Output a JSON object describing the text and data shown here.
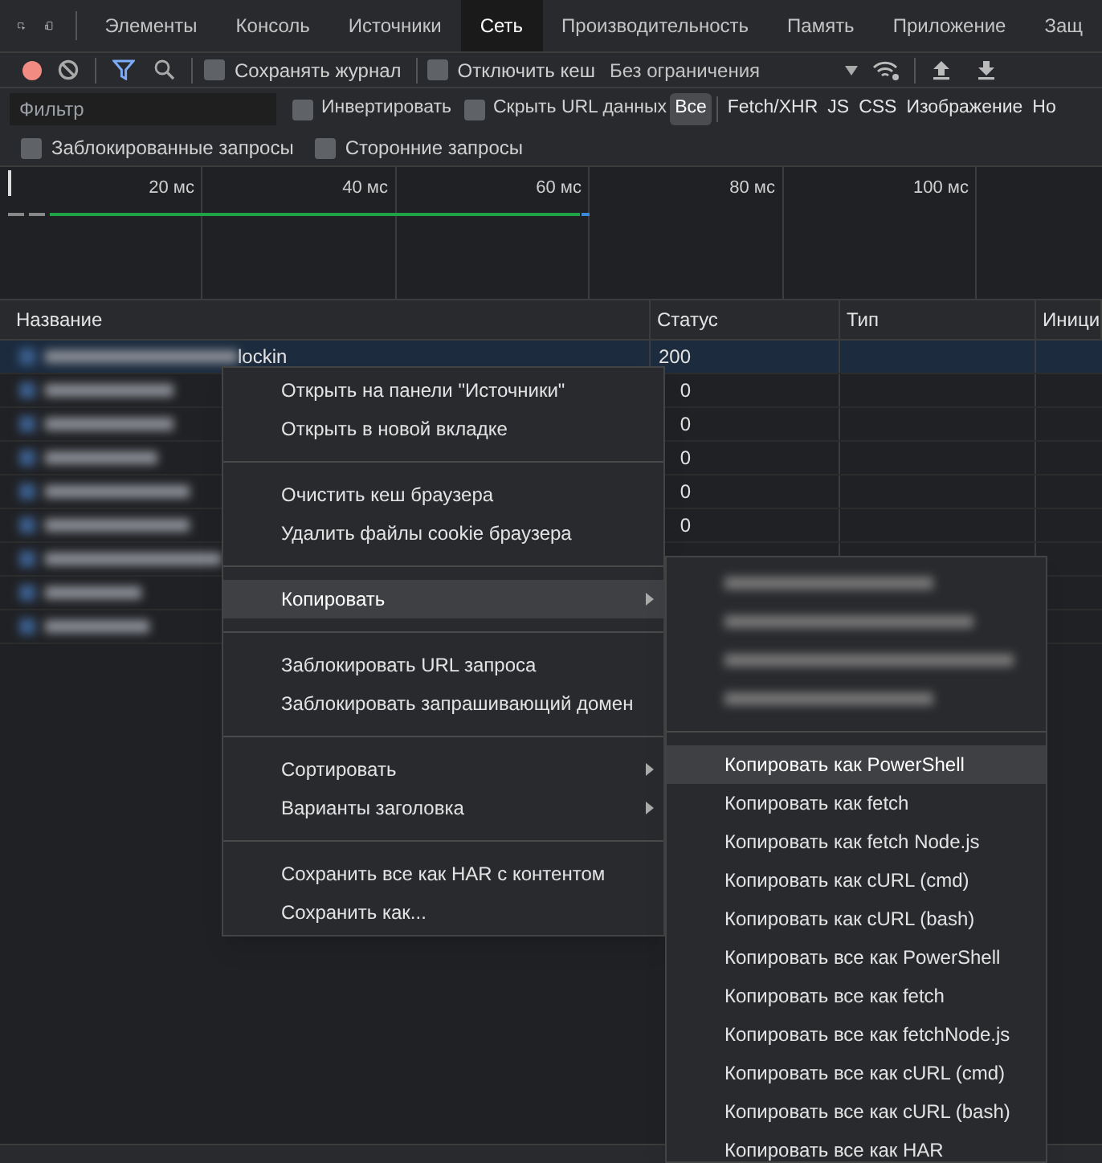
{
  "panel_tabs": [
    {
      "label": "Элементы",
      "selected": false
    },
    {
      "label": "Консоль",
      "selected": false
    },
    {
      "label": "Источники",
      "selected": false
    },
    {
      "label": "Сеть",
      "selected": true
    },
    {
      "label": "Производительность",
      "selected": false
    },
    {
      "label": "Память",
      "selected": false
    },
    {
      "label": "Приложение",
      "selected": false
    },
    {
      "label": "Защ",
      "selected": false
    }
  ],
  "toolbar": {
    "recording": true,
    "preserve_log": {
      "label": "Сохранять журнал",
      "checked": false
    },
    "disable_cache": {
      "label": "Отключить кеш",
      "checked": false
    },
    "throttling": "Без ограничения"
  },
  "filter_bar": {
    "placeholder": "Фильтр",
    "invert": {
      "label": "Инвертировать",
      "checked": false
    },
    "hide_data_urls": {
      "label": "Скрыть URL данных",
      "checked": false
    },
    "types": [
      {
        "label": "Все",
        "selected": true
      },
      {
        "label": "Fetch/XHR",
        "selected": false
      },
      {
        "label": "JS",
        "selected": false
      },
      {
        "label": "CSS",
        "selected": false
      },
      {
        "label": "Изображение",
        "selected": false
      },
      {
        "label": "Но",
        "selected": false
      }
    ],
    "blocked_requests": {
      "label": "Заблокированные запросы",
      "checked": false
    },
    "third_party": {
      "label": "Сторонние запросы",
      "checked": false
    }
  },
  "timeline": {
    "ticks": [
      "20 мс",
      "40 мс",
      "60 мс",
      "80 мс",
      "100 мс"
    ]
  },
  "table": {
    "columns": [
      "Название",
      "Статус",
      "Тип",
      "Иници"
    ],
    "rows": [
      {
        "selected": true,
        "name": "lockin",
        "status": "200"
      },
      {
        "selected": false,
        "status": "0"
      },
      {
        "selected": false,
        "status": "0"
      },
      {
        "selected": false,
        "status": "0"
      },
      {
        "selected": false,
        "status": "0"
      },
      {
        "selected": false,
        "status": "0"
      },
      {
        "selected": false
      },
      {
        "selected": false
      },
      {
        "selected": false
      }
    ]
  },
  "context_menu": {
    "items": [
      {
        "kind": "item",
        "label": "Открыть на панели \"Источники\"",
        "highlighted": false,
        "submenu": false
      },
      {
        "kind": "item",
        "label": "Открыть в новой вкладке",
        "highlighted": false,
        "submenu": false
      },
      {
        "kind": "separator"
      },
      {
        "kind": "item",
        "label": "Очистить кеш браузера",
        "highlighted": false,
        "submenu": false
      },
      {
        "kind": "item",
        "label": "Удалить файлы cookie браузера",
        "highlighted": false,
        "submenu": false
      },
      {
        "kind": "separator"
      },
      {
        "kind": "item",
        "label": "Копировать",
        "highlighted": true,
        "submenu": true
      },
      {
        "kind": "separator"
      },
      {
        "kind": "item",
        "label": "Заблокировать URL запроса",
        "highlighted": false,
        "submenu": false
      },
      {
        "kind": "item",
        "label": "Заблокировать запрашивающий домен",
        "highlighted": false,
        "submenu": false
      },
      {
        "kind": "separator"
      },
      {
        "kind": "item",
        "label": "Сортировать",
        "highlighted": false,
        "submenu": true
      },
      {
        "kind": "item",
        "label": "Варианты заголовка",
        "highlighted": false,
        "submenu": true
      },
      {
        "kind": "separator"
      },
      {
        "kind": "item",
        "label": "Сохранить все как HAR с контентом",
        "highlighted": false,
        "submenu": false
      },
      {
        "kind": "item",
        "label": "Сохранить как...",
        "highlighted": false,
        "submenu": false
      }
    ]
  },
  "copy_submenu": {
    "items": [
      {
        "kind": "blurred"
      },
      {
        "kind": "blurred"
      },
      {
        "kind": "blurred"
      },
      {
        "kind": "blurred"
      },
      {
        "kind": "separator"
      },
      {
        "kind": "item",
        "label": "Копировать как PowerShell",
        "highlighted": true
      },
      {
        "kind": "item",
        "label": "Копировать как fetch",
        "highlighted": false
      },
      {
        "kind": "item",
        "label": "Копировать как fetch Node.js",
        "highlighted": false
      },
      {
        "kind": "item",
        "label": "Копировать как cURL (cmd)",
        "highlighted": false
      },
      {
        "kind": "item",
        "label": "Копировать как cURL (bash)",
        "highlighted": false
      },
      {
        "kind": "item",
        "label": "Копировать все как PowerShell",
        "highlighted": false
      },
      {
        "kind": "item",
        "label": "Копировать все как fetch",
        "highlighted": false
      },
      {
        "kind": "item",
        "label": "Копировать все как fetchNode.js",
        "highlighted": false
      },
      {
        "kind": "item",
        "label": "Копировать все как cURL (cmd)",
        "highlighted": false
      },
      {
        "kind": "item",
        "label": "Копировать все как cURL (bash)",
        "highlighted": false
      },
      {
        "kind": "item",
        "label": "Копировать все как HAR",
        "highlighted": false
      }
    ]
  }
}
